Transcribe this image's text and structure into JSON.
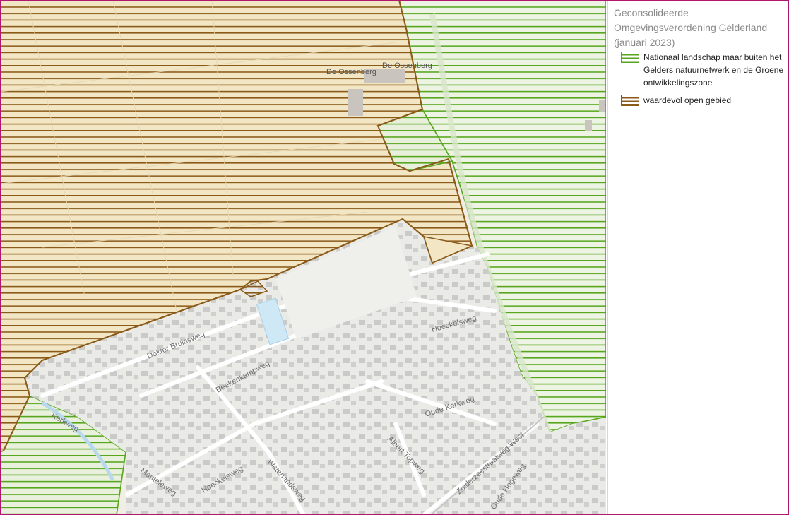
{
  "legend": {
    "title": "Geconsolideerde Omgevingsverordening Gelderland (januari 2023)",
    "items": [
      {
        "label": "Nationaal landschap maar buiten het Gelders natuurnetwerk en de Groene ontwikkelingszone",
        "color": "#57a61e",
        "pattern": "horizontal-hatch"
      },
      {
        "label": "waardevol open gebied",
        "color": "#8a5a19",
        "pattern": "horizontal-hatch"
      }
    ]
  },
  "map": {
    "place_labels": [
      "De Ossenberg",
      "De Ossenberg"
    ],
    "street_labels": [
      "Dokter Bruinsweg",
      "Beekenkampweg",
      "Hoeckelsweg",
      "Oude Kerkweg",
      "Albert Topweg",
      "Zuiderzeestraatweg West",
      "Oude Hogeweg",
      "Manteleweg",
      "Hoeckelsweg",
      "Waterlandsweg",
      "Kerkweg"
    ]
  },
  "colors": {
    "frame": "#b0176e",
    "green": "#57a61e",
    "brown": "#8a5a19",
    "field": "#f3e6c4",
    "urban": "#e9e9e6"
  }
}
